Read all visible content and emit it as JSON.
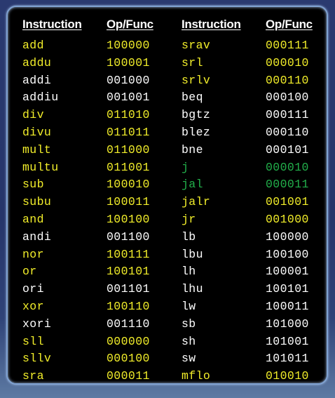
{
  "headers": {
    "left_instruction": "Instruction",
    "left_opfunc": "Op/Func",
    "right_instruction": "Instruction",
    "right_opfunc": "Op/Func"
  },
  "colors": {
    "yellow": "#f2ee2a",
    "white": "#ffffff",
    "green": "#22b04b",
    "frame_border": "#7fa2d2",
    "background": "#2a3a70"
  },
  "left_rows": [
    {
      "instruction": "add",
      "code": "100000",
      "color": "yellow"
    },
    {
      "instruction": "addu",
      "code": "100001",
      "color": "yellow"
    },
    {
      "instruction": "addi",
      "code": "001000",
      "color": "white"
    },
    {
      "instruction": "addiu",
      "code": "001001",
      "color": "white"
    },
    {
      "instruction": "div",
      "code": "011010",
      "color": "yellow"
    },
    {
      "instruction": "divu",
      "code": "011011",
      "color": "yellow"
    },
    {
      "instruction": "mult",
      "code": "011000",
      "color": "yellow"
    },
    {
      "instruction": "multu",
      "code": "011001",
      "color": "yellow"
    },
    {
      "instruction": "sub",
      "code": "100010",
      "color": "yellow"
    },
    {
      "instruction": "subu",
      "code": "100011",
      "color": "yellow"
    },
    {
      "instruction": "and",
      "code": "100100",
      "color": "yellow"
    },
    {
      "instruction": "andi",
      "code": "001100",
      "color": "white"
    },
    {
      "instruction": "nor",
      "code": "100111",
      "color": "yellow"
    },
    {
      "instruction": "or",
      "code": "100101",
      "color": "yellow"
    },
    {
      "instruction": "ori",
      "code": "001101",
      "color": "white"
    },
    {
      "instruction": "xor",
      "code": "100110",
      "color": "yellow"
    },
    {
      "instruction": "xori",
      "code": "001110",
      "color": "white"
    },
    {
      "instruction": "sll",
      "code": "000000",
      "color": "yellow"
    },
    {
      "instruction": "sllv",
      "code": "000100",
      "color": "yellow"
    },
    {
      "instruction": "sra",
      "code": "000011",
      "color": "yellow"
    }
  ],
  "right_rows": [
    {
      "instruction": "srav",
      "code": "000111",
      "color": "yellow"
    },
    {
      "instruction": "srl",
      "code": "000010",
      "color": "yellow"
    },
    {
      "instruction": "srlv",
      "code": "000110",
      "color": "yellow"
    },
    {
      "instruction": "beq",
      "code": "000100",
      "color": "white"
    },
    {
      "instruction": "bgtz",
      "code": "000111",
      "color": "white"
    },
    {
      "instruction": "blez",
      "code": "000110",
      "color": "white"
    },
    {
      "instruction": "bne",
      "code": "000101",
      "color": "white"
    },
    {
      "instruction": "j",
      "code": "000010",
      "color": "green"
    },
    {
      "instruction": "jal",
      "code": "000011",
      "color": "green"
    },
    {
      "instruction": "jalr",
      "code": "001001",
      "color": "yellow"
    },
    {
      "instruction": "jr",
      "code": "001000",
      "color": "yellow"
    },
    {
      "instruction": "lb",
      "code": "100000",
      "color": "white"
    },
    {
      "instruction": "lbu",
      "code": "100100",
      "color": "white"
    },
    {
      "instruction": "lh",
      "code": "100001",
      "color": "white"
    },
    {
      "instruction": "lhu",
      "code": "100101",
      "color": "white"
    },
    {
      "instruction": "lw",
      "code": "100011",
      "color": "white"
    },
    {
      "instruction": "sb",
      "code": "101000",
      "color": "white"
    },
    {
      "instruction": "sh",
      "code": "101001",
      "color": "white"
    },
    {
      "instruction": "sw",
      "code": "101011",
      "color": "white"
    },
    {
      "instruction": "mflo",
      "code": "010010",
      "color": "yellow"
    }
  ]
}
